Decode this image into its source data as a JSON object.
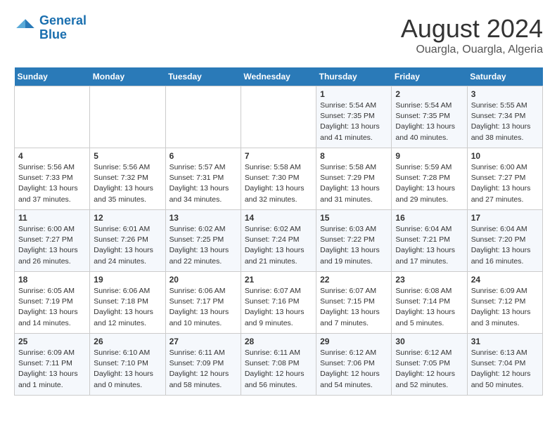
{
  "header": {
    "logo_line1": "General",
    "logo_line2": "Blue",
    "title": "August 2024",
    "subtitle": "Ouargla, Ouargla, Algeria"
  },
  "weekdays": [
    "Sunday",
    "Monday",
    "Tuesday",
    "Wednesday",
    "Thursday",
    "Friday",
    "Saturday"
  ],
  "weeks": [
    [
      {
        "day": "",
        "info": ""
      },
      {
        "day": "",
        "info": ""
      },
      {
        "day": "",
        "info": ""
      },
      {
        "day": "",
        "info": ""
      },
      {
        "day": "1",
        "info": "Sunrise: 5:54 AM\nSunset: 7:35 PM\nDaylight: 13 hours\nand 41 minutes."
      },
      {
        "day": "2",
        "info": "Sunrise: 5:54 AM\nSunset: 7:35 PM\nDaylight: 13 hours\nand 40 minutes."
      },
      {
        "day": "3",
        "info": "Sunrise: 5:55 AM\nSunset: 7:34 PM\nDaylight: 13 hours\nand 38 minutes."
      }
    ],
    [
      {
        "day": "4",
        "info": "Sunrise: 5:56 AM\nSunset: 7:33 PM\nDaylight: 13 hours\nand 37 minutes."
      },
      {
        "day": "5",
        "info": "Sunrise: 5:56 AM\nSunset: 7:32 PM\nDaylight: 13 hours\nand 35 minutes."
      },
      {
        "day": "6",
        "info": "Sunrise: 5:57 AM\nSunset: 7:31 PM\nDaylight: 13 hours\nand 34 minutes."
      },
      {
        "day": "7",
        "info": "Sunrise: 5:58 AM\nSunset: 7:30 PM\nDaylight: 13 hours\nand 32 minutes."
      },
      {
        "day": "8",
        "info": "Sunrise: 5:58 AM\nSunset: 7:29 PM\nDaylight: 13 hours\nand 31 minutes."
      },
      {
        "day": "9",
        "info": "Sunrise: 5:59 AM\nSunset: 7:28 PM\nDaylight: 13 hours\nand 29 minutes."
      },
      {
        "day": "10",
        "info": "Sunrise: 6:00 AM\nSunset: 7:27 PM\nDaylight: 13 hours\nand 27 minutes."
      }
    ],
    [
      {
        "day": "11",
        "info": "Sunrise: 6:00 AM\nSunset: 7:27 PM\nDaylight: 13 hours\nand 26 minutes."
      },
      {
        "day": "12",
        "info": "Sunrise: 6:01 AM\nSunset: 7:26 PM\nDaylight: 13 hours\nand 24 minutes."
      },
      {
        "day": "13",
        "info": "Sunrise: 6:02 AM\nSunset: 7:25 PM\nDaylight: 13 hours\nand 22 minutes."
      },
      {
        "day": "14",
        "info": "Sunrise: 6:02 AM\nSunset: 7:24 PM\nDaylight: 13 hours\nand 21 minutes."
      },
      {
        "day": "15",
        "info": "Sunrise: 6:03 AM\nSunset: 7:22 PM\nDaylight: 13 hours\nand 19 minutes."
      },
      {
        "day": "16",
        "info": "Sunrise: 6:04 AM\nSunset: 7:21 PM\nDaylight: 13 hours\nand 17 minutes."
      },
      {
        "day": "17",
        "info": "Sunrise: 6:04 AM\nSunset: 7:20 PM\nDaylight: 13 hours\nand 16 minutes."
      }
    ],
    [
      {
        "day": "18",
        "info": "Sunrise: 6:05 AM\nSunset: 7:19 PM\nDaylight: 13 hours\nand 14 minutes."
      },
      {
        "day": "19",
        "info": "Sunrise: 6:06 AM\nSunset: 7:18 PM\nDaylight: 13 hours\nand 12 minutes."
      },
      {
        "day": "20",
        "info": "Sunrise: 6:06 AM\nSunset: 7:17 PM\nDaylight: 13 hours\nand 10 minutes."
      },
      {
        "day": "21",
        "info": "Sunrise: 6:07 AM\nSunset: 7:16 PM\nDaylight: 13 hours\nand 9 minutes."
      },
      {
        "day": "22",
        "info": "Sunrise: 6:07 AM\nSunset: 7:15 PM\nDaylight: 13 hours\nand 7 minutes."
      },
      {
        "day": "23",
        "info": "Sunrise: 6:08 AM\nSunset: 7:14 PM\nDaylight: 13 hours\nand 5 minutes."
      },
      {
        "day": "24",
        "info": "Sunrise: 6:09 AM\nSunset: 7:12 PM\nDaylight: 13 hours\nand 3 minutes."
      }
    ],
    [
      {
        "day": "25",
        "info": "Sunrise: 6:09 AM\nSunset: 7:11 PM\nDaylight: 13 hours\nand 1 minute."
      },
      {
        "day": "26",
        "info": "Sunrise: 6:10 AM\nSunset: 7:10 PM\nDaylight: 13 hours\nand 0 minutes."
      },
      {
        "day": "27",
        "info": "Sunrise: 6:11 AM\nSunset: 7:09 PM\nDaylight: 12 hours\nand 58 minutes."
      },
      {
        "day": "28",
        "info": "Sunrise: 6:11 AM\nSunset: 7:08 PM\nDaylight: 12 hours\nand 56 minutes."
      },
      {
        "day": "29",
        "info": "Sunrise: 6:12 AM\nSunset: 7:06 PM\nDaylight: 12 hours\nand 54 minutes."
      },
      {
        "day": "30",
        "info": "Sunrise: 6:12 AM\nSunset: 7:05 PM\nDaylight: 12 hours\nand 52 minutes."
      },
      {
        "day": "31",
        "info": "Sunrise: 6:13 AM\nSunset: 7:04 PM\nDaylight: 12 hours\nand 50 minutes."
      }
    ]
  ]
}
